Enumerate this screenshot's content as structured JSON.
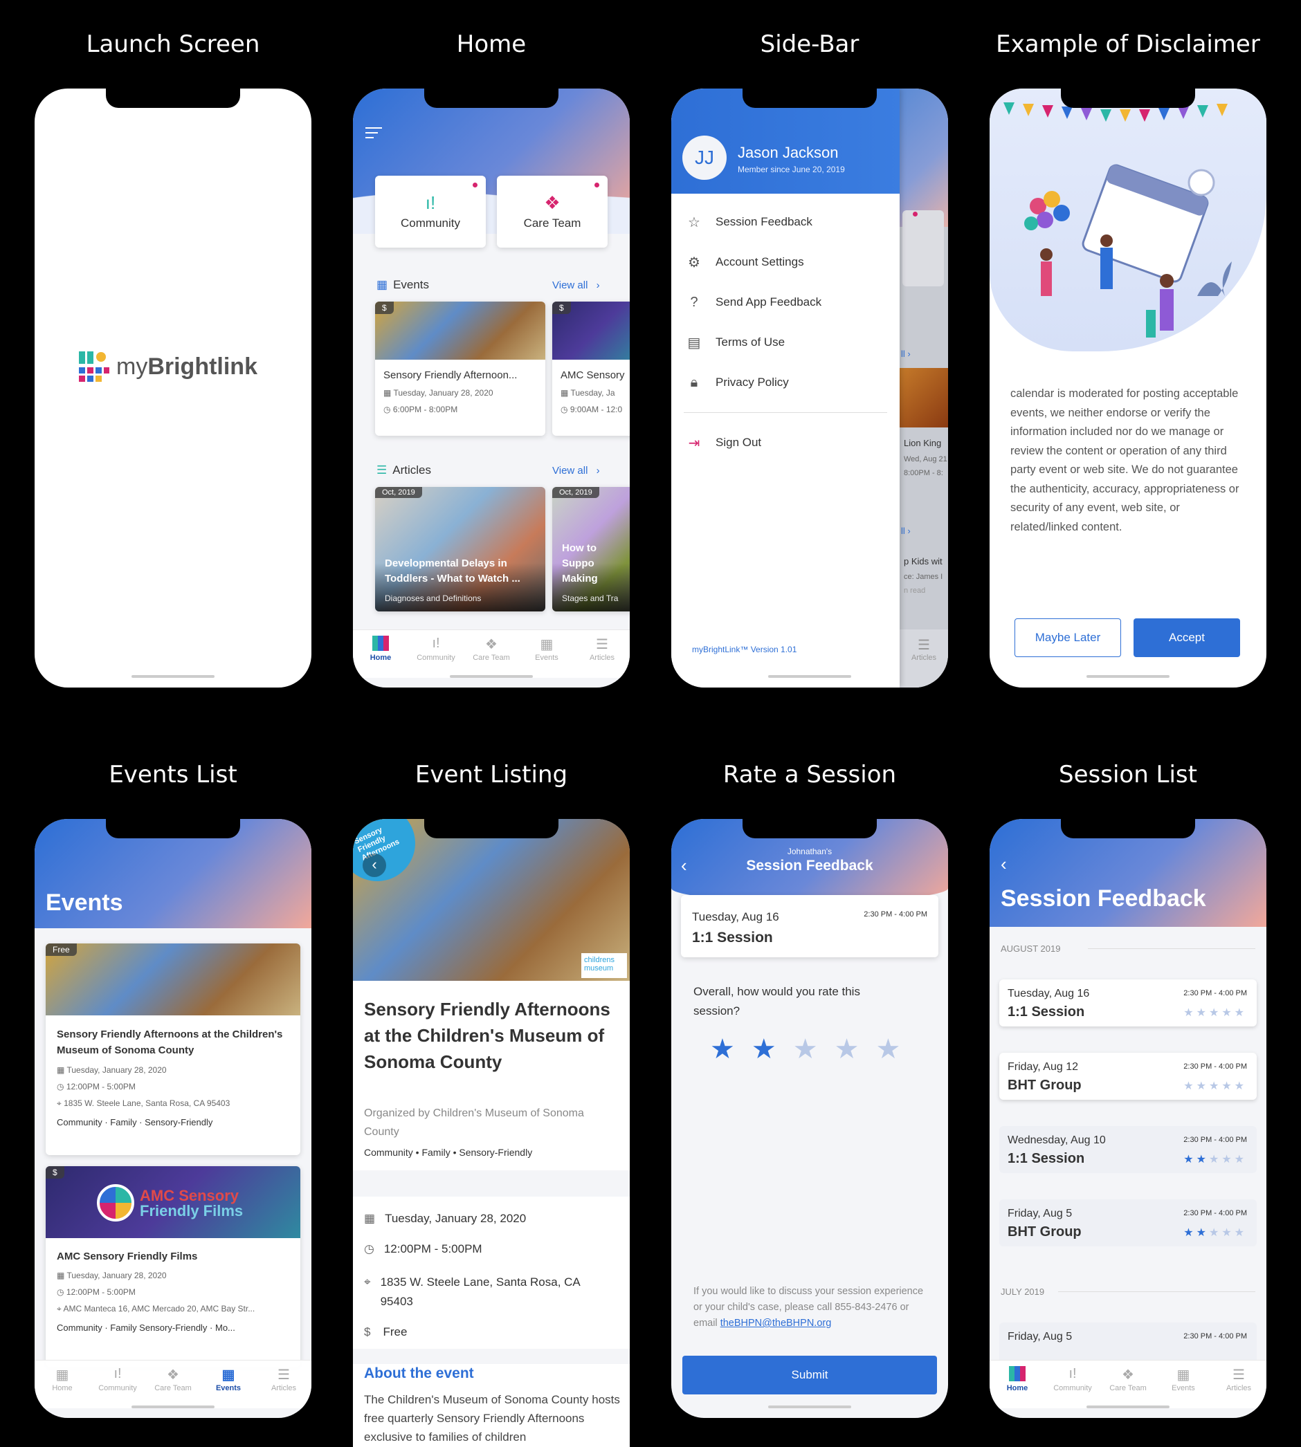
{
  "titles": [
    "Launch Screen",
    "Home",
    "Side-Bar",
    "Example of Disclaimer",
    "Events List",
    "Event Listing",
    "Rate a Session",
    "Session List"
  ],
  "brand": {
    "name_prefix": "my",
    "name_bold": "Brightlink"
  },
  "home": {
    "community": "Community",
    "care_team": "Care Team",
    "events_title": "Events",
    "articles_title": "Articles",
    "view_all": "View all",
    "event1": {
      "price": "$",
      "title": "Sensory Friendly Afternoon...",
      "date": "Tuesday, January 28, 2020",
      "time": "6:00PM - 8:00PM"
    },
    "event2": {
      "price": "$",
      "title": "AMC Sensory",
      "date": "Tuesday, Ja",
      "time": "9:00AM - 12:0"
    },
    "article1": {
      "date": "Oct, 2019",
      "title": "Developmental Delays in Toddlers - What to Watch ...",
      "sub": "Diagnoses and Definitions"
    },
    "article2": {
      "date": "Oct, 2019",
      "title": "How to Suppo Making",
      "sub": "Stages and Tra"
    },
    "tabs": [
      "Home",
      "Community",
      "Care Team",
      "Events",
      "Articles"
    ]
  },
  "sidebar": {
    "initials": "JJ",
    "name": "Jason Jackson",
    "since": "Member since June 20, 2019",
    "items": [
      "Session Feedback",
      "Account Settings",
      "Send App Feedback",
      "Terms of Use",
      "Privacy Policy"
    ],
    "signout": "Sign Out",
    "version": "myBrightLink™ Version 1.01",
    "behind": {
      "view_all": "ll",
      "event": "Lion King",
      "date": "Wed, Aug 21",
      "time": "8:00PM - 8:",
      "article": "p Kids wit",
      "author": "ce: James I",
      "read": "n read",
      "tab": "Articles"
    }
  },
  "disclaimer": {
    "text": "calendar is moderated for posting acceptable events, we neither endorse or verify the information included nor do we manage or review the content or operation of any third party event or web site. We do not guarantee the authenticity, accuracy, appropriateness or security of any event, web site, or related/linked content.",
    "later": "Maybe Later",
    "accept": "Accept"
  },
  "events_list": {
    "title": "Events",
    "e1": {
      "price": "Free",
      "title": "Sensory Friendly Afternoons at the Children's Museum of Sonoma County",
      "date": "Tuesday, January 28, 2020",
      "time": "12:00PM - 5:00PM",
      "addr": "1835 W. Steele Lane, Santa Rosa, CA 95403",
      "tags": "Community · Family · Sensory-Friendly"
    },
    "e2": {
      "price": "$",
      "banner1": "AMC Sensory",
      "banner2": "Friendly Films",
      "title": "AMC Sensory Friendly Films",
      "date": "Tuesday, January 28, 2020",
      "time": "12:00PM - 5:00PM",
      "addr": "AMC Manteca 16, AMC Mercado 20, AMC Bay Str...",
      "tags": "Community · Family  Sensory-Friendly · Mo..."
    },
    "tabs": [
      "Home",
      "Community",
      "Care Team",
      "Events",
      "Articles"
    ]
  },
  "event_listing": {
    "badge": "Sensory Friendly Afternoons",
    "title": "Sensory Friendly Afternoons at the Children's Museum of Sonoma County",
    "org": "Organized by Children's Museum of Sonoma County",
    "tags": "Community • Family • Sensory-Friendly",
    "date": "Tuesday, January 28, 2020",
    "time": "12:00PM - 5:00PM",
    "addr": "1835 W. Steele Lane, Santa Rosa, CA 95403",
    "price": "Free",
    "about_title": "About the event",
    "about": "The Children's Museum of Sonoma County hosts free quarterly Sensory Friendly Afternoons exclusive to families of children",
    "logo": "childrens museum"
  },
  "rate": {
    "sub": "Johnathan's",
    "title": "Session Feedback",
    "day": "Tuesday, Aug 16",
    "time": "2:30 PM - 4:00 PM",
    "name": "1:1 Session",
    "question": "Overall, how would you rate this session?",
    "rating": 2,
    "contact": "If you would like to discuss your session experience or your child's case, please call 855-843-2476 or email ",
    "email": "theBHPN@theBHPN.org",
    "submit": "Submit"
  },
  "session_list": {
    "title": "Session Feedback",
    "month1": "AUGUST 2019",
    "month2": "JULY 2019",
    "sessions": [
      {
        "day": "Tuesday, Aug 16",
        "time": "2:30 PM - 4:00 PM",
        "name": "1:1 Session",
        "rating": 0
      },
      {
        "day": "Friday, Aug 12",
        "time": "2:30 PM - 4:00 PM",
        "name": "BHT Group",
        "rating": 0
      },
      {
        "day": "Wednesday, Aug 10",
        "time": "2:30 PM - 4:00 PM",
        "name": "1:1 Session",
        "rating": 2
      },
      {
        "day": "Friday, Aug 5",
        "time": "2:30 PM - 4:00 PM",
        "name": "BHT Group",
        "rating": 2
      },
      {
        "day": "Friday, Aug 5",
        "time": "2:30 PM - 4:00 PM",
        "name": "",
        "rating": 0
      }
    ],
    "tabs": [
      "Home",
      "Community",
      "Care Team",
      "Events",
      "Articles"
    ]
  },
  "colors": {
    "primary": "#2e6fd6",
    "accent_pink": "#d6246e",
    "star_filled": "#2e6fd6",
    "star_empty": "#b8c8e6"
  }
}
